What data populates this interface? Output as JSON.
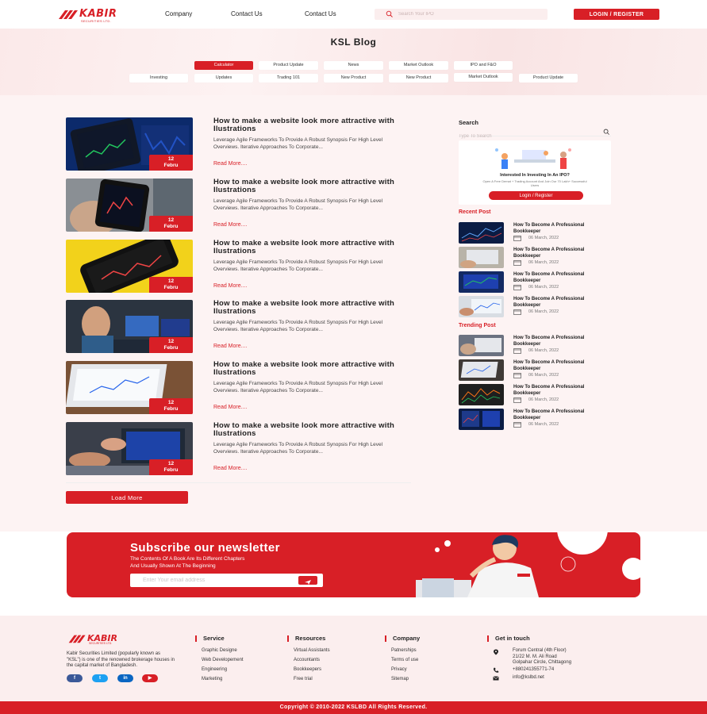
{
  "header": {
    "logo_name": "KABIR",
    "logo_sub": "SECURITIES LTD.",
    "nav": [
      "Company",
      "Contact Us",
      "Contact Us"
    ],
    "search_placeholder": "Search Your IPO",
    "login_label": "LOGIN / REGISTER"
  },
  "hero": {
    "title": "KSL Blog",
    "categories_row1": [
      "Calculator",
      "Product Update",
      "News",
      "Market Outlook",
      "IPO and F&O"
    ],
    "categories_row2": [
      "Investing",
      "Updates",
      "Trading 101",
      "New Product",
      "New Product",
      "Market Outlook",
      "Product Update"
    ],
    "active_category": "Calculator"
  },
  "posts": [
    {
      "title": "How to make a website look more attractive with Ilustrations",
      "excerpt": "Leverage Agile Frameworks To Provide A Robust Synopsis For High Level Overviews. Iterative Approaches To Corporate...",
      "date_day": "12",
      "date_month": "Febru",
      "read_more": "Read More...."
    },
    {
      "title": "How to make a website look more attractive with Ilustrations",
      "excerpt": "Leverage Agile Frameworks To Provide A Robust Synopsis For High Level Overviews. Iterative Approaches To Corporate...",
      "date_day": "12",
      "date_month": "Febru",
      "read_more": "Read More...."
    },
    {
      "title": "How to make a website look more attractive with Ilustrations",
      "excerpt": "Leverage Agile Frameworks To Provide A Robust Synopsis For High Level Overviews. Iterative Approaches To Corporate...",
      "date_day": "12",
      "date_month": "Febru",
      "read_more": "Read More...."
    },
    {
      "title": "How to make a website look more attractive with Ilustrations",
      "excerpt": "Leverage Agile Frameworks To Provide A Robust Synopsis For High Level Overviews. Iterative Approaches To Corporate...",
      "date_day": "12",
      "date_month": "Febru",
      "read_more": "Read More...."
    },
    {
      "title": "How to make a website look more attractive with Ilustrations",
      "excerpt": "Leverage Agile Frameworks To Provide A Robust Synopsis For High Level Overviews. Iterative Approaches To Corporate...",
      "date_day": "12",
      "date_month": "Febru",
      "read_more": "Read More...."
    },
    {
      "title": "How to make a website look more attractive with Ilustrations",
      "excerpt": "Leverage Agile Frameworks To Provide A Robust Synopsis For High Level Overviews. Iterative Approaches To Corporate...",
      "date_day": "12",
      "date_month": "Febru",
      "read_more": "Read More...."
    }
  ],
  "load_more": "Load More",
  "sidebar": {
    "search_title": "Search",
    "search_placeholder": "Type To Search",
    "ipo_title": "Interested In Investing In An IPO?",
    "ipo_desc": "Open A Free Demat + Trading Account And Join Our 70 Lakh+ Successful Users",
    "ipo_button": "Login / Register",
    "recent_title": "Recent Post",
    "recent": [
      {
        "title": "How To Become A Professional Bookkeeper",
        "date": "06 March, 2022"
      },
      {
        "title": "How To Become A Professional Bookkeeper",
        "date": "06 March, 2022"
      },
      {
        "title": "How To Become A Professional Bookkeeper",
        "date": "06 March, 2022"
      },
      {
        "title": "How To Become A Professional Bookkeeper",
        "date": "06 March, 2022"
      }
    ],
    "trending_title": "Trending Post",
    "trending": [
      {
        "title": "How To Become A Professional Bookkeeper",
        "date": "06 March, 2022"
      },
      {
        "title": "How To Become A Professional Bookkeeper",
        "date": "06 March, 2022"
      },
      {
        "title": "How To Become A Professional Bookkeeper",
        "date": "06 March, 2022"
      },
      {
        "title": "How To Become A Professional Bookkeeper",
        "date": "06 March, 2022"
      }
    ]
  },
  "newsletter": {
    "title": "Subscribe our newsletter",
    "subtitle_line1": "The Contents Of A Book Are Its Different Chapters",
    "subtitle_line2": "And Usually Shown  At The Beginning",
    "email_placeholder": "Enter Your email address"
  },
  "footer": {
    "logo_name": "KABIR",
    "logo_sub": "SECURITIES LTD.",
    "description": "Kabir Securities Limited (popularly known as \"KSL\") is one of the renowned brokerage houses in the capital market of Bangladesh.",
    "social": [
      "f",
      "t",
      "in",
      "▶"
    ],
    "service_title": "Service",
    "service": [
      "Graphic Designe",
      "Web Developement",
      "Engineering",
      "Marketing"
    ],
    "resources_title": "Resources",
    "resources": [
      "Virtual Assistants",
      "Accountants",
      "Bookkeepers",
      "Free trial"
    ],
    "company_title": "Company",
    "company": [
      "Patnerships",
      "Terms of use",
      "Privacy",
      "Sitemap"
    ],
    "contact_title": "Get in touch",
    "address_line1": "Forum Central (4th Floor)",
    "address_line2": "21/22 M. M. Ali Road",
    "address_line3": "Golpahar Circle, Chittagong",
    "phone": "+880241355771-74",
    "email": "info@kslbd.net",
    "copyright": "Copyright ©  2010-2022 KSLBD All Rights Reserved."
  },
  "colors": {
    "brand": "#d81f26",
    "hero_bg": "#fbe9e9"
  }
}
